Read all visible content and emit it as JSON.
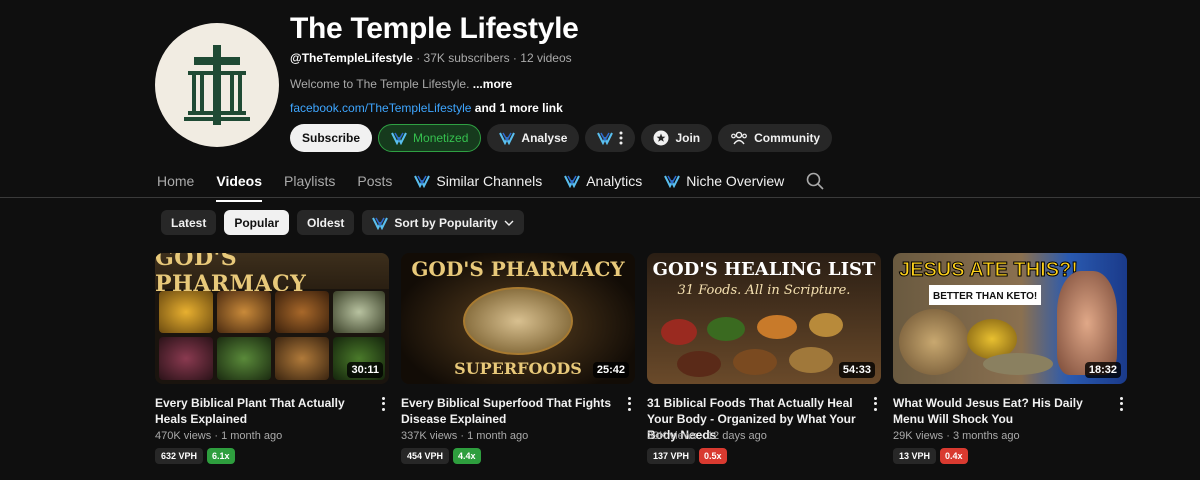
{
  "channel": {
    "name": "The Temple Lifestyle",
    "handle": "@TheTempleLifestyle",
    "subscribers": "37K subscribers",
    "videos_count": "12 videos",
    "description": "Welcome to The Temple Lifestyle.",
    "more": "...more",
    "link_text": "facebook.com/TheTempleLifestyle",
    "more_links": "and 1 more link",
    "separator": "·"
  },
  "actions": {
    "subscribe": "Subscribe",
    "monetized": "Monetized",
    "analyse": "Analyse",
    "join": "Join",
    "community": "Community"
  },
  "tabs": [
    {
      "label": "Home"
    },
    {
      "label": "Videos"
    },
    {
      "label": "Playlists"
    },
    {
      "label": "Posts"
    },
    {
      "label": "Similar Channels"
    },
    {
      "label": "Analytics"
    },
    {
      "label": "Niche Overview"
    }
  ],
  "filters": {
    "latest": "Latest",
    "popular": "Popular",
    "oldest": "Oldest",
    "sort": "Sort by Popularity"
  },
  "videos": [
    {
      "title": "Every Biblical Plant That Actually Heals Explained",
      "duration": "30:11",
      "views": "470K views",
      "age": "1 month ago",
      "vph": "632 VPH",
      "outlier": "6.1x",
      "thumb_text": "GOD'S PHARMACY",
      "outlier_color": "#2e9e3e"
    },
    {
      "title": "Every Biblical Superfood That Fights Disease Explained",
      "duration": "25:42",
      "views": "337K views",
      "age": "1 month ago",
      "vph": "454 VPH",
      "outlier": "4.4x",
      "thumb_text": "GOD'S PHARMACY",
      "thumb_sub": "SUPERFOODS",
      "outlier_color": "#2e9e3e"
    },
    {
      "title": "31 Biblical Foods That Actually Heal Your Body - Organized by What Your Body Needs",
      "duration": "54:33",
      "views": "39K views",
      "age": "12 days ago",
      "vph": "137 VPH",
      "outlier": "0.5x",
      "thumb_text": "GOD'S HEALING LIST",
      "thumb_sub": "31 Foods. All in Scripture.",
      "outlier_color": "#d93a30"
    },
    {
      "title": "What Would Jesus Eat? His Daily Menu Will Shock You",
      "duration": "18:32",
      "views": "29K views",
      "age": "3 months ago",
      "vph": "13 VPH",
      "outlier": "0.4x",
      "thumb_text": "JESUS ATE THIS?!",
      "thumb_sub": "BETTER THAN KETO!",
      "outlier_color": "#d93a30"
    }
  ]
}
